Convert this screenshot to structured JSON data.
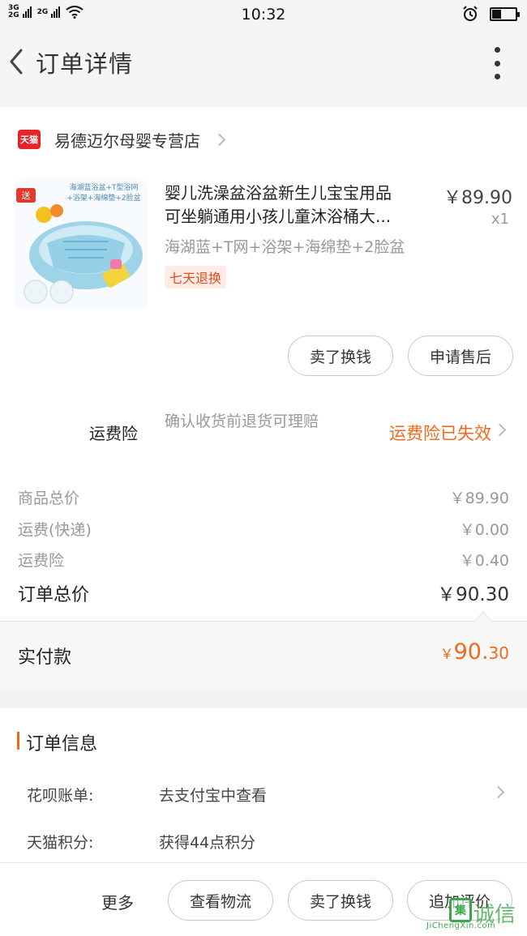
{
  "status_bar": {
    "net_top": "3G",
    "net_bottom": "2G",
    "net_mid": "2G",
    "time": "10:32"
  },
  "header": {
    "title": "订单详情"
  },
  "shop": {
    "badge": "天猫",
    "name": "易德迈尔母婴专营店"
  },
  "product": {
    "title_line1": "婴儿洗澡盆浴盆新生儿宝宝用品",
    "title_line2": "可坐躺通用小孩儿童沐浴桶大...",
    "price": "￥89.90",
    "quantity": "x1",
    "sku": "海湖蓝+T网+浴架+海绵垫+2脸盆",
    "return_badge": "七天退换",
    "image_tag": "送",
    "image_caption": "海湖蓝浴盆+T型浴网+浴架+海绵垫+2脸盆"
  },
  "item_actions": {
    "sell": "卖了换钱",
    "aftersale": "申请售后"
  },
  "insurance": {
    "label": "运费险",
    "desc": "确认收货前退货可理赔",
    "status": "运费险已失效"
  },
  "fees": [
    {
      "label": "商品总价",
      "value": "￥89.90"
    },
    {
      "label": "运费(快递)",
      "value": "￥0.00"
    },
    {
      "label": "运费险",
      "value": "￥0.40"
    }
  ],
  "total": {
    "label": "订单总价",
    "value": "￥90.30"
  },
  "payment": {
    "label": "实付款",
    "currency": "￥",
    "integer": "90.",
    "decimal": "30"
  },
  "order_info": {
    "title": "订单信息",
    "rows": [
      {
        "label": "花呗账单:",
        "value": "去支付宝中查看"
      },
      {
        "label": "天猫积分:",
        "value": "获得44点积分"
      }
    ]
  },
  "bottom_bar": {
    "more": "更多",
    "logistics": "查看物流",
    "sell": "卖了换钱",
    "review": "追加评价"
  },
  "watermark": {
    "logo": "集",
    "text": "诚信",
    "sub": "JiChengXin.com"
  },
  "colors": {
    "accent": "#ef6a1a",
    "tmall_red": "#e8232a",
    "muted_text": "#999999"
  }
}
